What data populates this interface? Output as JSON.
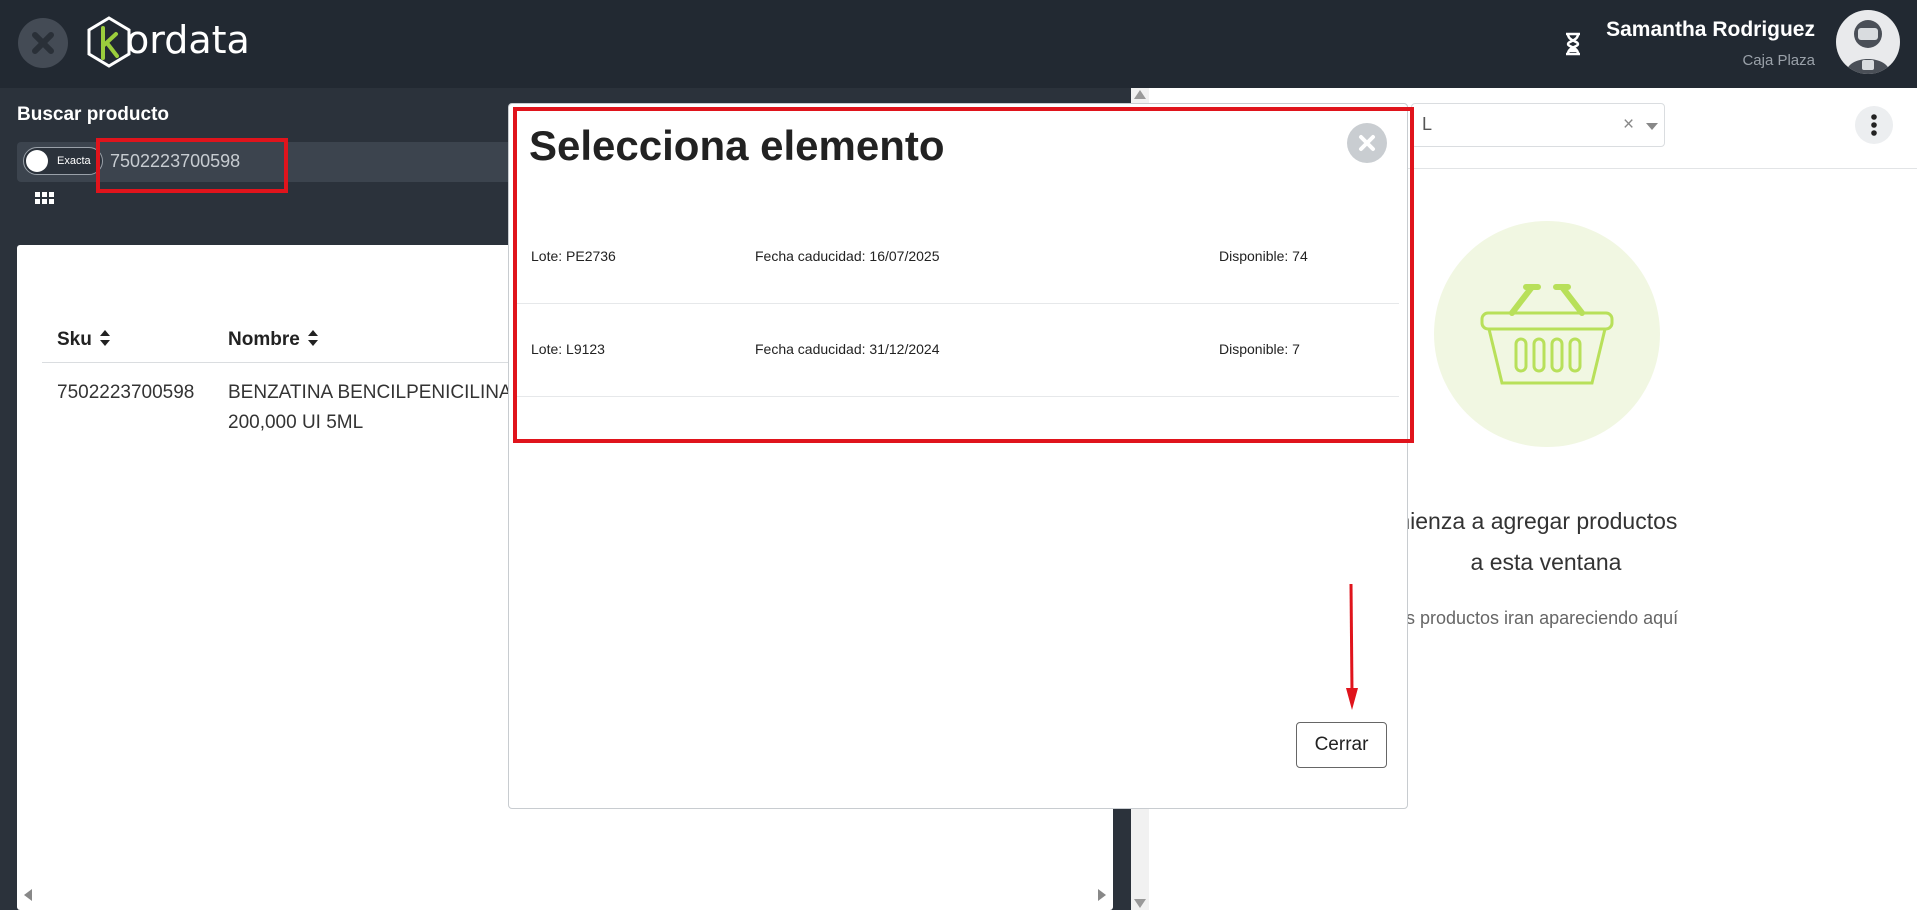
{
  "header": {
    "logo_text": "ordata",
    "user_name": "Samantha Rodriguez",
    "user_store": "Caja Plaza"
  },
  "search": {
    "label": "Buscar producto",
    "toggle_label": "Exacta",
    "value": "7502223700598"
  },
  "table": {
    "columns": [
      "Sku",
      "Nombre"
    ],
    "rows": [
      {
        "sku": "7502223700598",
        "name_line1": "BENZATINA BENCILPENICILINA",
        "name_line2": "200,000 UI 5ML"
      }
    ]
  },
  "right_panel": {
    "select_text": "L",
    "clear_glyph": "×",
    "empty_title_line1": "mienza a agregar productos",
    "empty_title_line2": "a esta ventana",
    "empty_subtitle": "s productos iran apareciendo aquí"
  },
  "modal": {
    "title": "Selecciona elemento",
    "items": [
      {
        "lote": "Lote: PE2736",
        "fecha": "Fecha caducidad: 16/07/2025",
        "disponible": "Disponible: 74"
      },
      {
        "lote": "Lote: L9123",
        "fecha": "Fecha caducidad: 31/12/2024",
        "disponible": "Disponible: 7"
      }
    ],
    "close_button": "Cerrar"
  },
  "colors": {
    "topbar": "#222932",
    "accent_green": "#9bcd3c",
    "highlight_red": "#e0141c"
  }
}
